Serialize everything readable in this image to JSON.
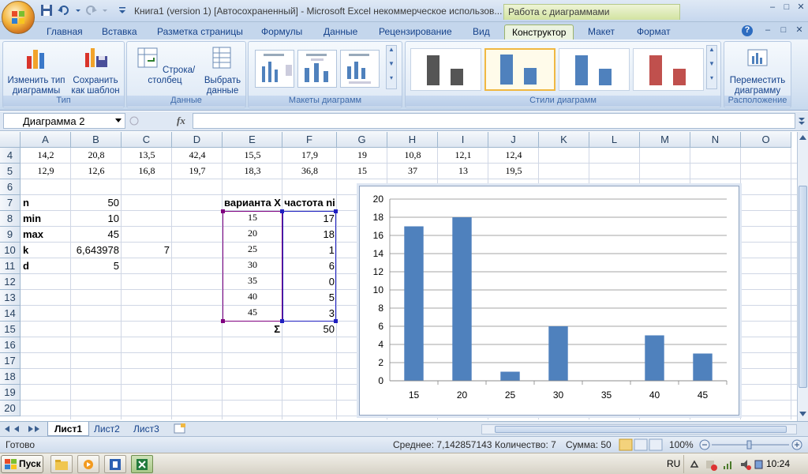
{
  "window": {
    "title": "Книга1 (version 1) [Автосохраненный] - Microsoft Excel некоммерческое использов...",
    "context_title": "Работа с диаграммами",
    "controls": [
      "–",
      "□",
      "✕"
    ],
    "inner_controls": [
      "?",
      "–",
      "□",
      "✕"
    ]
  },
  "tabs": [
    "Главная",
    "Вставка",
    "Разметка страницы",
    "Формулы",
    "Данные",
    "Рецензирование",
    "Вид",
    "Конструктор",
    "Макет",
    "Формат"
  ],
  "active_tab": "Конструктор",
  "ribbon": {
    "group_type": {
      "label": "Тип",
      "btn1": "Изменить тип диаграммы",
      "btn2": "Сохранить как шаблон"
    },
    "group_data": {
      "label": "Данные",
      "btn1": "Строка/столбец",
      "btn2": "Выбрать данные"
    },
    "group_layouts": {
      "label": "Макеты диаграмм"
    },
    "group_styles": {
      "label": "Стили диаграмм"
    },
    "group_location": {
      "label": "Расположение",
      "btn1": "Переместить диаграмму"
    }
  },
  "formula_bar": {
    "name_box": "Диаграмма 2",
    "fx": "fx",
    "value": ""
  },
  "grid": {
    "columns": [
      "A",
      "B",
      "C",
      "D",
      "E",
      "F",
      "G",
      "H",
      "I",
      "J",
      "K",
      "L",
      "M",
      "N",
      "O"
    ],
    "rows": [
      "4",
      "5",
      "6",
      "7",
      "8",
      "9",
      "10",
      "11",
      "12",
      "13",
      "14",
      "15",
      "16",
      "17",
      "18",
      "19",
      "20"
    ],
    "row4": [
      "14,2",
      "20,8",
      "13,5",
      "42,4",
      "15,5",
      "17,9",
      "19",
      "10,8",
      "12,1",
      "12,4"
    ],
    "row5": [
      "12,9",
      "12,6",
      "16,8",
      "19,7",
      "18,3",
      "36,8",
      "15",
      "37",
      "13",
      "19,5"
    ],
    "stats_labels": [
      "n",
      "min",
      "max",
      "k",
      "d"
    ],
    "stats_values": [
      "50",
      "10",
      "45",
      "6,643978",
      "5"
    ],
    "k_rounded": "7",
    "table_header_x": "варианта X",
    "table_header_n": "частота ni",
    "variants": [
      "15",
      "20",
      "25",
      "30",
      "35",
      "40",
      "45"
    ],
    "frequencies": [
      "17",
      "18",
      "1",
      "6",
      "0",
      "5",
      "3"
    ],
    "sigma": "Σ",
    "sum": "50"
  },
  "chart_data": {
    "type": "bar",
    "categories": [
      "15",
      "20",
      "25",
      "30",
      "35",
      "40",
      "45"
    ],
    "values": [
      17,
      18,
      1,
      6,
      0,
      5,
      3
    ],
    "title": "",
    "xlabel": "",
    "ylabel": "",
    "ylim": [
      0,
      20
    ],
    "yticks": [
      "0",
      "2",
      "4",
      "6",
      "8",
      "10",
      "12",
      "14",
      "16",
      "18",
      "20"
    ],
    "grid": true,
    "legend": "none",
    "bar_color": "#4f81bd"
  },
  "sheets": [
    "Лист1",
    "Лист2",
    "Лист3"
  ],
  "active_sheet": "Лист1",
  "status": {
    "ready": "Готово",
    "average": "Среднее: 7,142857143",
    "count": "Количество: 7",
    "sum": "Сумма: 50",
    "zoom": "100%"
  },
  "taskbar": {
    "start": "Пуск",
    "lang": "RU",
    "time": "10:24"
  },
  "colors": {
    "accent": "#15428b",
    "bar": "#4f81bd",
    "context_tab": "#d2e3a1",
    "selection": "#800080"
  }
}
